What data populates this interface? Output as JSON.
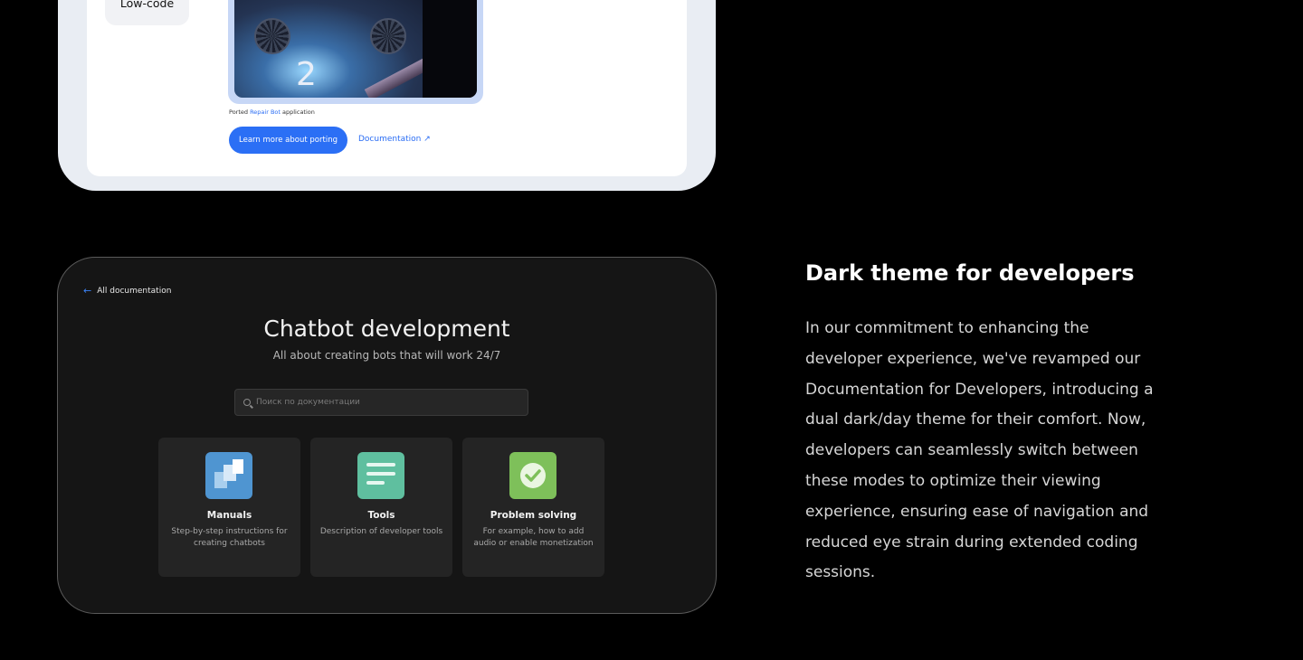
{
  "top_card": {
    "pill_label": "Low-code",
    "game_number": "2",
    "caption_prefix": "Ported ",
    "caption_link": "Repair Bot",
    "caption_suffix": " application",
    "learn_button": "Learn more about porting",
    "doc_link": "Documentation ↗"
  },
  "dark_card": {
    "back_label": "All documentation",
    "title": "Chatbot development",
    "subtitle": "All about creating bots that will work 24/7",
    "search_placeholder": "Поиск по документации",
    "tiles": [
      {
        "name": "Manuals",
        "desc": "Step-by-step instructions for creating chatbots",
        "icon": "manuals-icon",
        "color": "#4f95d1"
      },
      {
        "name": "Tools",
        "desc": "Description of developer tools",
        "icon": "tools-icon",
        "color": "#5fbf9f"
      },
      {
        "name": "Problem solving",
        "desc": "For example, how to add audio or enable monetization",
        "icon": "checkmark-icon",
        "color": "#7ec05a"
      }
    ]
  },
  "section": {
    "heading": "Dark theme for developers",
    "body": "In our commitment to enhancing the developer experience, we've revamped our Documentation for Developers, introducing a dual dark/day theme for their comfort. Now, developers can seamlessly switch between these modes to optimize their viewing experience, ensuring ease of navigation and reduced eye strain during extended coding sessions."
  },
  "colors": {
    "accent": "#2b6ff5",
    "background": "#000000",
    "dark_card": "#151515"
  }
}
